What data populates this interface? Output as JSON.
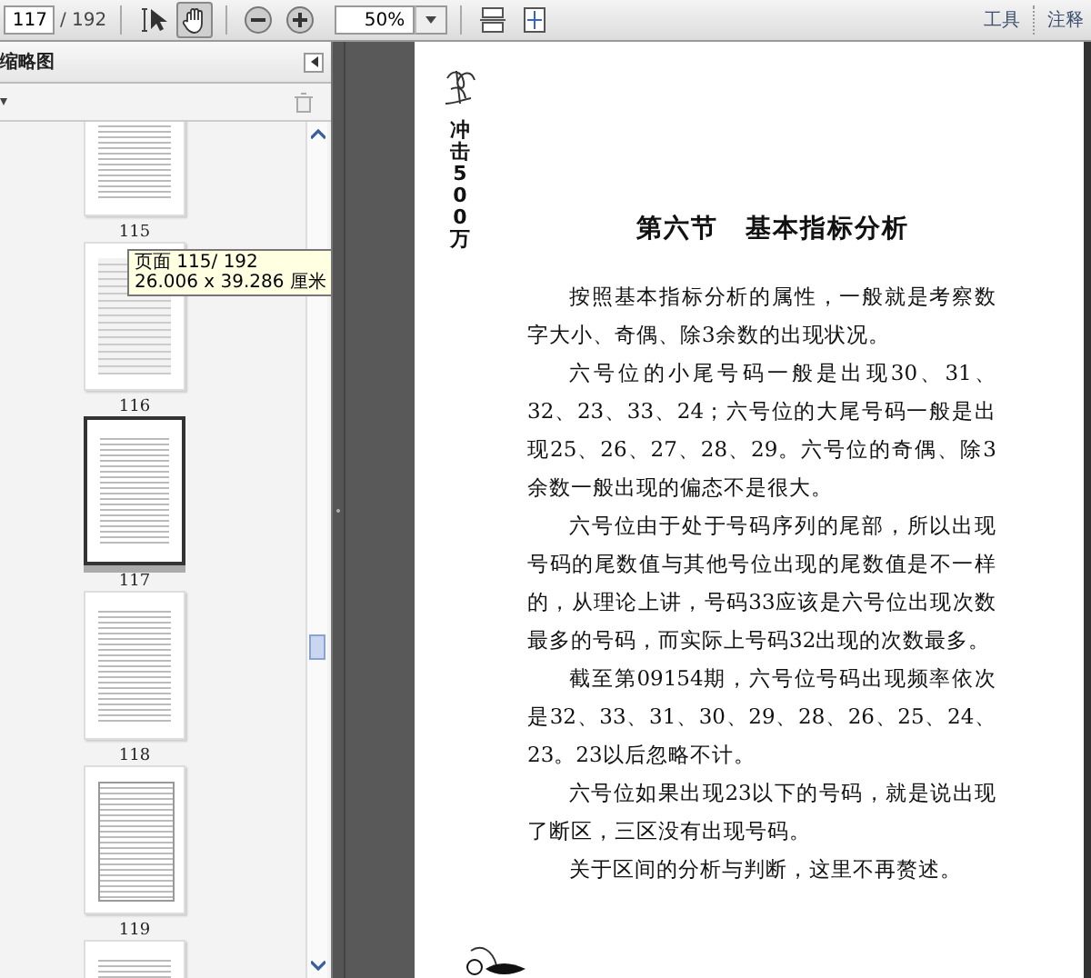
{
  "toolbar": {
    "page_field": {
      "value": "117"
    },
    "page_total": "/ 192",
    "tools": [
      {
        "kind": "select",
        "selected": false
      },
      {
        "kind": "hand",
        "selected": true
      }
    ],
    "zoom_field": {
      "value": "50%"
    },
    "menu": [
      {
        "label": "工具"
      },
      {
        "label": "注释"
      }
    ]
  },
  "sidebar": {
    "title": "缩略图",
    "thumbnails": [
      {
        "label": "115",
        "selected": false,
        "kind": "text"
      },
      {
        "label": "116",
        "selected": false,
        "kind": "table"
      },
      {
        "label": "117",
        "selected": true,
        "kind": "text"
      },
      {
        "label": "118",
        "selected": false,
        "kind": "text"
      },
      {
        "label": "119",
        "selected": false,
        "kind": "boxed"
      },
      {
        "selected": false,
        "kind": "text"
      }
    ],
    "tooltip": {
      "lines": [
        "页面 115/ 192",
        "26.006 x 39.286 厘米"
      ]
    }
  },
  "document": {
    "side_title": "冲击500万",
    "heading": "第六节　基本指标分析",
    "paragraphs": [
      "按照基本指标分析的属性，一般就是考察数字大小、奇偶、除3余数的出现状况。",
      "六号位的小尾号码一般是出现30、31、32、23、33、24；六号位的大尾号码一般是出现25、26、27、28、29。六号位的奇偶、除3余数一般出现的偏态不是很大。",
      "六号位由于处于号码序列的尾部，所以出现号码的尾数值与其他号位出现的尾数值是不一样的，从理论上讲，号码33应该是六号位出现次数最多的号码，而实际上号码32出现的次数最多。",
      "截至第09154期，六号位号码出现频率依次是32、33、31、30、29、28、26、25、24、23。23以后忽略不计。",
      "六号位如果出现23以下的号码，就是说出现了断区，三区没有出现号码。",
      "关于区间的分析与判断，这里不再赘述。"
    ]
  }
}
